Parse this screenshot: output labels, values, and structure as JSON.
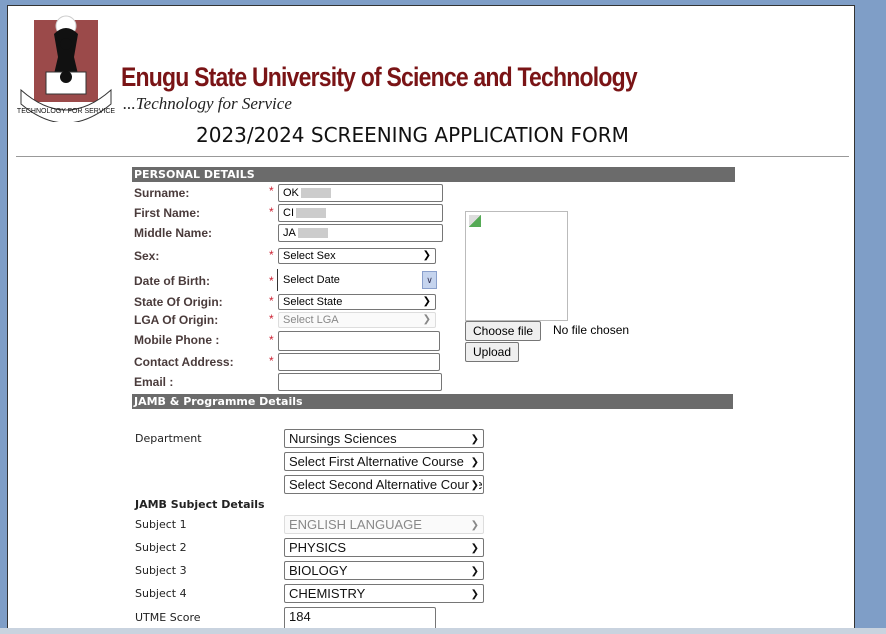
{
  "header": {
    "university": "Enugu State University of Science and Technology",
    "tagline": "...Technology for Service",
    "logo_text": "TECHNOLOGY FOR SERVICE",
    "form_title": "2023/2024 SCREENING APPLICATION FORM"
  },
  "personal": {
    "section_title": "PERSONAL DETAILS",
    "surname": {
      "label": "Surname:",
      "value": "OK"
    },
    "first_name": {
      "label": "First Name:",
      "value": "CI"
    },
    "middle_name": {
      "label": "Middle Name:",
      "value": "JA"
    },
    "sex": {
      "label": "Sex:",
      "value": "Select Sex"
    },
    "dob": {
      "label": "Date of Birth:",
      "value": "Select Date"
    },
    "state": {
      "label": "State Of Origin:",
      "value": "Select State"
    },
    "lga": {
      "label": "LGA Of Origin:",
      "value": "Select LGA"
    },
    "phone": {
      "label": "Mobile Phone :",
      "value": ""
    },
    "address": {
      "label": "Contact Address:",
      "value": ""
    },
    "email": {
      "label": "Email :",
      "value": ""
    },
    "required_mark": "*",
    "photo": {
      "choose_label": "Choose file",
      "file_status": "No file chosen",
      "upload_label": "Upload"
    }
  },
  "jamb": {
    "section_title": "JAMB & Programme Details",
    "department_label": "Department",
    "department": "Nursings Sciences",
    "alt1": "Select First Alternative Course",
    "alt2": "Select Second Alternative Course",
    "subjects_title": "JAMB Subject Details",
    "subjects": [
      {
        "label": "Subject 1",
        "value": "ENGLISH LANGUAGE"
      },
      {
        "label": "Subject 2",
        "value": "PHYSICS"
      },
      {
        "label": "Subject 3",
        "value": "BIOLOGY"
      },
      {
        "label": "Subject 4",
        "value": "CHEMISTRY"
      }
    ],
    "utme_label": "UTME Score",
    "utme_score": "184"
  },
  "colors": {
    "brand": "#7a1416",
    "section_bg": "#6b6b6b",
    "frame": "#7f9ec7"
  }
}
